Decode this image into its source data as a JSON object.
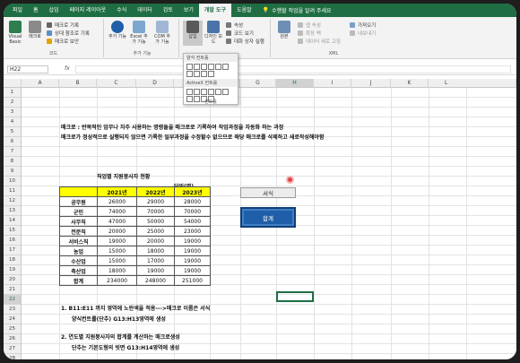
{
  "tabs": [
    "파일",
    "홈",
    "삽입",
    "페이지 레이아웃",
    "수식",
    "데이터",
    "검토",
    "보기",
    "개발 도구",
    "도움말"
  ],
  "active_tab": "개발 도구",
  "tell_me": "수행할 작업을 알려 주세요",
  "ribbon": {
    "code": {
      "visual_basic": "Visual Basic",
      "macro": "매크로",
      "record_macro": "매크로 기록",
      "relative_ref": "상대 참조로 기록",
      "macro_security": "매크로 보안",
      "label": "코드"
    },
    "addins": {
      "addin": "추가 기능",
      "excel_addin": "Excel 추가 기능",
      "com_addin": "COM 추가 기능",
      "label": "추가 기능"
    },
    "controls": {
      "insert": "삽입",
      "design_mode": "디자인 모드",
      "properties": "속성",
      "view_code": "코드 보기",
      "run_dialog": "대화 상자 실행",
      "form_controls": "양식 컨트롤",
      "activex": "ActiveX 컨트롤",
      "label": "컨트롤"
    },
    "xml": {
      "source": "원본",
      "map_props": "맵 속성",
      "expansion": "확장 팩",
      "refresh": "데이터 새로 고침",
      "import": "가져오기",
      "export": "내보내기",
      "label": "XML"
    }
  },
  "name_box": "H22",
  "fx": "fx",
  "columns": [
    "A",
    "B",
    "C",
    "D",
    "E",
    "F",
    "G",
    "H",
    "I",
    "J",
    "K",
    "L"
  ],
  "selected_column": "H",
  "rows": [
    "1",
    "2",
    "3",
    "4",
    "5",
    "6",
    "7",
    "8",
    "9",
    "10",
    "11",
    "12",
    "13",
    "14",
    "15",
    "16",
    "17",
    "18",
    "19",
    "20",
    "21",
    "22",
    "23",
    "24",
    "25",
    "26",
    "27",
    "28"
  ],
  "selected_row": "22",
  "notes": {
    "line1": "매크로 : 반복적인 업무나 자주 사용하는 명령들을 매크로로 기록하여 작업과정을 자동화 하는 과정",
    "line2": "매크로가 정상적으로 실행되지 않으면 기록한 일부과정을 수정할수 없으므로 해당 매크로를 삭제하고 새로작성해야함"
  },
  "table": {
    "title": "직업별 지원봉사자 현황",
    "unit": "단위(명)",
    "headers": [
      "",
      "2021년",
      "2022년",
      "2023년"
    ],
    "rows": [
      [
        "공무원",
        "26000",
        "29000",
        "28000"
      ],
      [
        "군인",
        "74000",
        "70000",
        "70000"
      ],
      [
        "사무직",
        "47000",
        "50000",
        "54000"
      ],
      [
        "전문직",
        "20000",
        "25000",
        "23000"
      ],
      [
        "서비스직",
        "19000",
        "20000",
        "19000"
      ],
      [
        "농업",
        "15000",
        "18000",
        "19000"
      ],
      [
        "수산업",
        "15000",
        "17000",
        "19000"
      ],
      [
        "축산업",
        "18000",
        "19000",
        "19000"
      ],
      [
        "합계",
        "234000",
        "248000",
        "251000"
      ]
    ]
  },
  "buttons": {
    "format": "서식",
    "total": "합계"
  },
  "steps": {
    "s1a": "1. B11:E11 까지 영역에 노란색을 적용--->매크로 이름은 서식",
    "s1b": "양식컨트롤(단추) G13:H13영역에 생성",
    "s2a": "2. 연도별 지원봉사자의 합계를 계산하는 매크로생성",
    "s2b": "단추는 기본도형의 빗면 G13:H14영역에 생성"
  }
}
